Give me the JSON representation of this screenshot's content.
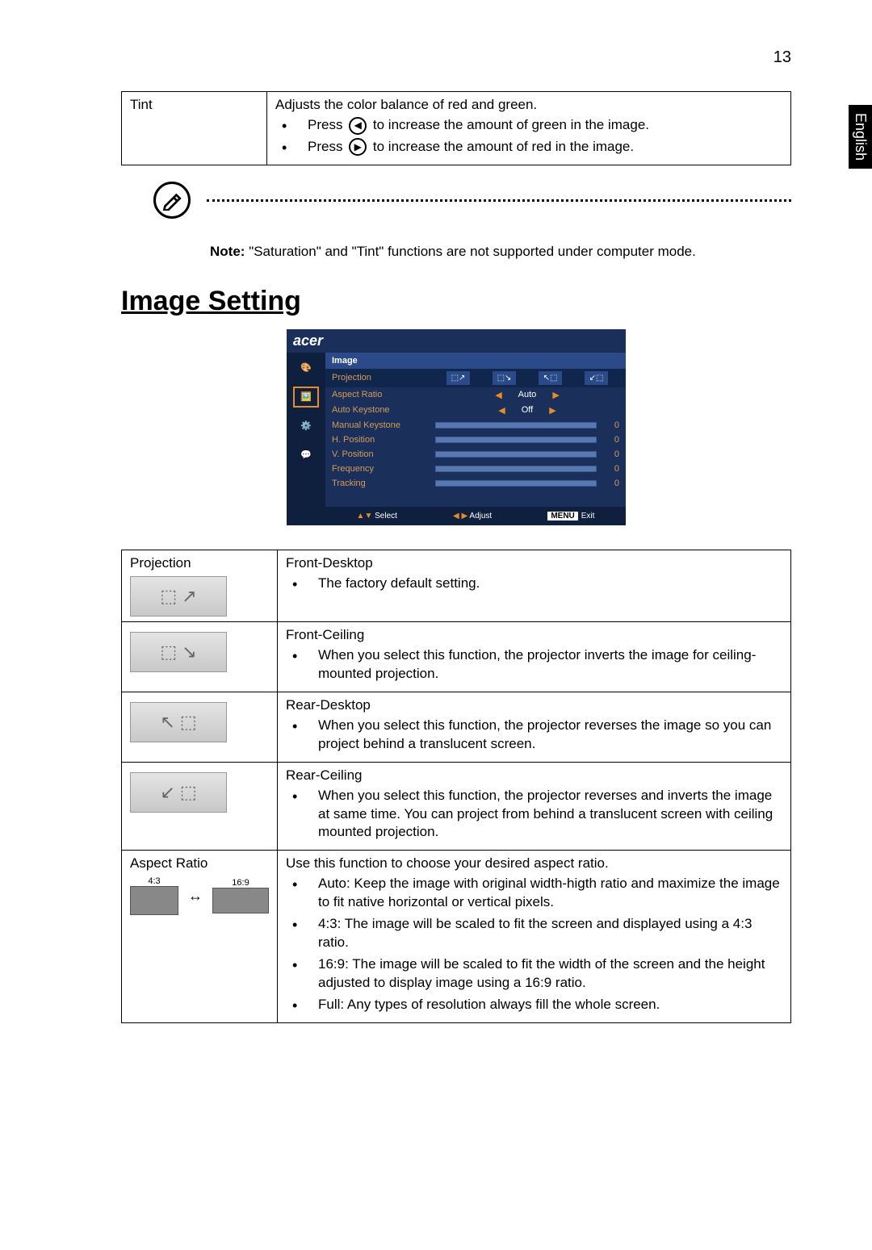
{
  "page_number": "13",
  "side_tab": "English",
  "tint_table": {
    "label": "Tint",
    "desc": "Adjusts the color balance of red and green.",
    "line1_pre": "Press ",
    "line1_post": " to increase the amount of green in the image.",
    "line2_pre": "Press ",
    "line2_post": " to increase the amount of red in the image."
  },
  "note": {
    "prefix": "Note:",
    "text": "\"Saturation\" and \"Tint\" functions are not supported under computer mode."
  },
  "section_heading": "Image Setting",
  "osd": {
    "brand": "acer",
    "title": "Image",
    "rows": {
      "projection": "Projection",
      "aspect_ratio": "Aspect Ratio",
      "aspect_value": "Auto",
      "auto_keystone": "Auto Keystone",
      "auto_keystone_value": "Off",
      "manual_keystone": "Manual Keystone",
      "h_position": "H. Position",
      "v_position": "V. Position",
      "frequency": "Frequency",
      "tracking": "Tracking",
      "zero": "0"
    },
    "footer": {
      "select": "Select",
      "adjust": "Adjust",
      "menu": "MENU",
      "exit": "Exit"
    }
  },
  "projection_table": {
    "r1": {
      "label": "Projection",
      "title": "Front-Desktop",
      "b1": "The factory default setting."
    },
    "r2": {
      "title": "Front-Ceiling",
      "b1": "When you select this function, the projector inverts the image for ceiling-mounted projection."
    },
    "r3": {
      "title": "Rear-Desktop",
      "b1": "When you select this function, the projector reverses the image so you can project behind a translucent screen."
    },
    "r4": {
      "title": "Rear-Ceiling",
      "b1": "When you select this function, the projector reverses and inverts the image at same time. You can project from behind a translucent screen with ceiling mounted projection."
    },
    "r5": {
      "label": "Aspect Ratio",
      "title": "Use this function to choose your desired aspect ratio.",
      "b1": "Auto: Keep the image with original width-higth ratio and maximize the image to fit native horizontal or vertical pixels.",
      "b2": "4:3: The image will be scaled to fit the screen and displayed using a 4:3 ratio.",
      "b3": "16:9: The image will be scaled to fit the width of the screen and the height adjusted to display image using a 16:9 ratio.",
      "b4": "Full: Any types of resolution always fill the whole screen.",
      "ratio_a": "4:3",
      "ratio_b": "16:9"
    }
  }
}
